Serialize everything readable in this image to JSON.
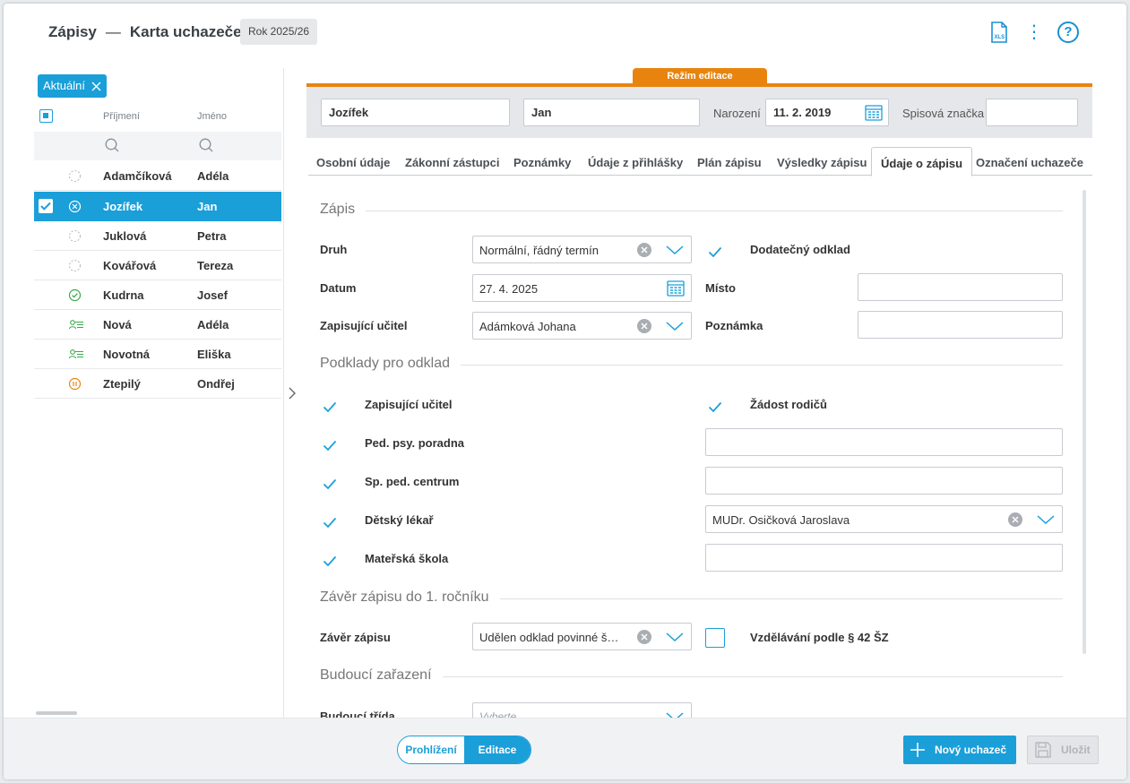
{
  "header": {
    "title": "Zápisy",
    "separator": "—",
    "subtitle": "Karta uchazeče",
    "year_badge": "Rok 2025/26",
    "xls_icon": "xls-icon",
    "kebab_icon": "kebab-icon",
    "help_icon": "?"
  },
  "list": {
    "filter_chip": "Aktuální",
    "col_surname": "Příjmení",
    "col_name": "Jméno",
    "rows": [
      {
        "surname": "Adamčíková",
        "name": "Adéla",
        "status": "empty-circle"
      },
      {
        "surname": "Jozífek",
        "name": "Jan",
        "status": "x-circle",
        "selected": true
      },
      {
        "surname": "Juklová",
        "name": "Petra",
        "status": "empty-circle"
      },
      {
        "surname": "Kovářová",
        "name": "Tereza",
        "status": "empty-circle"
      },
      {
        "surname": "Kudrna",
        "name": "Josef",
        "status": "check-circle"
      },
      {
        "surname": "Nová",
        "name": "Adéla",
        "status": "id-card"
      },
      {
        "surname": "Novotná",
        "name": "Eliška",
        "status": "id-card"
      },
      {
        "surname": "Ztepilý",
        "name": "Ondřej",
        "status": "pause-circle"
      }
    ]
  },
  "edit_mode_label": "Režim editace",
  "applicant": {
    "surname": "Jozífek",
    "name": "Jan",
    "birth_label": "Narození",
    "birth_date": "11. 2. 2019",
    "file_label": "Spisová značka",
    "file_value": ""
  },
  "tabs": [
    "Osobní údaje",
    "Zákonní zástupci",
    "Poznámky",
    "Údaje z přihlášky",
    "Plán zápisu",
    "Výsledky zápisu",
    "Údaje o zápisu",
    "Označení uchazeče"
  ],
  "active_tab": "Údaje o zápisu",
  "zapis": {
    "title": "Zápis",
    "druh_label": "Druh",
    "druh_value": "Normální, řádný termín",
    "dodatecny_label": "Dodatečný odklad",
    "datum_label": "Datum",
    "datum_value": "27. 4. 2025",
    "misto_label": "Místo",
    "misto_value": "",
    "ucitel_label": "Zapisující učitel",
    "ucitel_value": "Adámková Johana",
    "poznamka_label": "Poznámka",
    "poznamka_value": ""
  },
  "podklady": {
    "title": "Podklady pro odklad",
    "items": {
      "ucitel": "Zapisující učitel",
      "zadost": "Žádost rodičů",
      "poradna": "Ped. psy. poradna",
      "centrum": "Sp. ped. centrum",
      "lekar": "Dětský lékař",
      "lekar_value": "MUDr. Osičková Jaroslava",
      "skola": "Mateřská škola"
    }
  },
  "zaver": {
    "title": "Závěr zápisu do 1. ročníku",
    "label": "Závěr zápisu",
    "value": "Udělen odklad povinné š…",
    "paragraph_label": "Vzdělávání podle § 42 ŠZ"
  },
  "budouci": {
    "title": "Budoucí zařazení",
    "trida_label": "Budoucí třída",
    "trida_placeholder": "Vyberte"
  },
  "footer": {
    "view_label": "Prohlížení",
    "edit_label": "Editace",
    "new_label": "Nový uchazeč",
    "save_label": "Uložit"
  },
  "colors": {
    "accent": "#1a9fd9",
    "edit_mode": "#e8840e"
  }
}
